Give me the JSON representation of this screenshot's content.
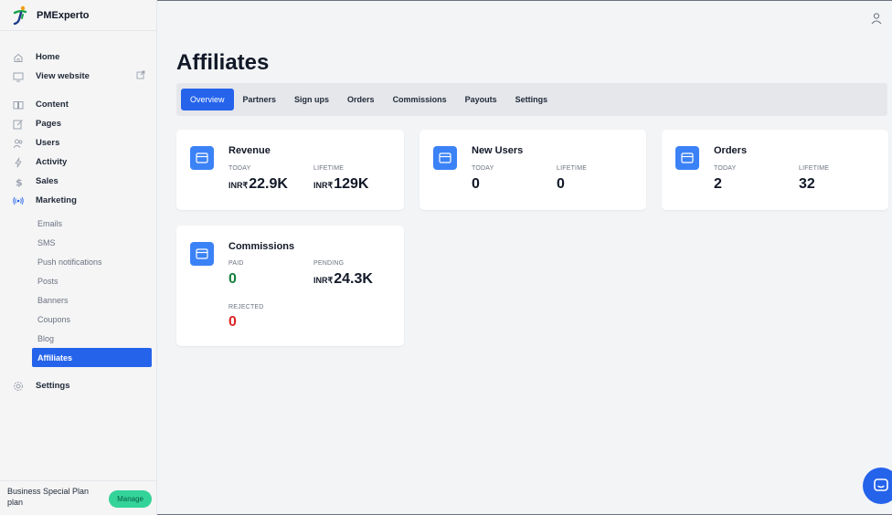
{
  "app": {
    "name": "PMExperto"
  },
  "sidebar": {
    "nav": [
      {
        "label": "Home",
        "icon": "home-icon"
      },
      {
        "label": "View website",
        "icon": "monitor-icon"
      },
      {
        "label": "Content",
        "icon": "book-icon"
      },
      {
        "label": "Pages",
        "icon": "edit-icon"
      },
      {
        "label": "Users",
        "icon": "users-icon"
      },
      {
        "label": "Activity",
        "icon": "activity-icon"
      },
      {
        "label": "Sales",
        "icon": "dollar-icon"
      },
      {
        "label": "Marketing",
        "icon": "broadcast-icon"
      }
    ],
    "marketing_sub": [
      "Emails",
      "SMS",
      "Push notifications",
      "Posts",
      "Banners",
      "Coupons",
      "Blog",
      "Affiliates"
    ],
    "active_sub": "Affiliates",
    "settings_label": "Settings",
    "plan_text": "Business Special Plan plan",
    "manage_label": "Manage"
  },
  "page": {
    "title": "Affiliates"
  },
  "tabs": [
    "Overview",
    "Partners",
    "Sign ups",
    "Orders",
    "Commissions",
    "Payouts",
    "Settings"
  ],
  "active_tab": "Overview",
  "cards": {
    "revenue": {
      "title": "Revenue",
      "today_label": "TODAY",
      "today_cur": "INR₹",
      "today_value": "22.9K",
      "lifetime_label": "LIFETIME",
      "lifetime_cur": "INR₹",
      "lifetime_value": "129K"
    },
    "new_users": {
      "title": "New Users",
      "today_label": "TODAY",
      "today_value": "0",
      "lifetime_label": "LIFETIME",
      "lifetime_value": "0"
    },
    "orders": {
      "title": "Orders",
      "today_label": "TODAY",
      "today_value": "2",
      "lifetime_label": "LIFETIME",
      "lifetime_value": "32"
    },
    "commissions": {
      "title": "Commissions",
      "paid_label": "PAID",
      "paid_value": "0",
      "pending_label": "PENDING",
      "pending_cur": "INR₹",
      "pending_value": "24.3K",
      "rejected_label": "REJECTED",
      "rejected_value": "0"
    }
  },
  "colors": {
    "accent": "#2563eb",
    "paid": "#15803d",
    "rejected": "#dc2626",
    "manage": "#34d399"
  }
}
